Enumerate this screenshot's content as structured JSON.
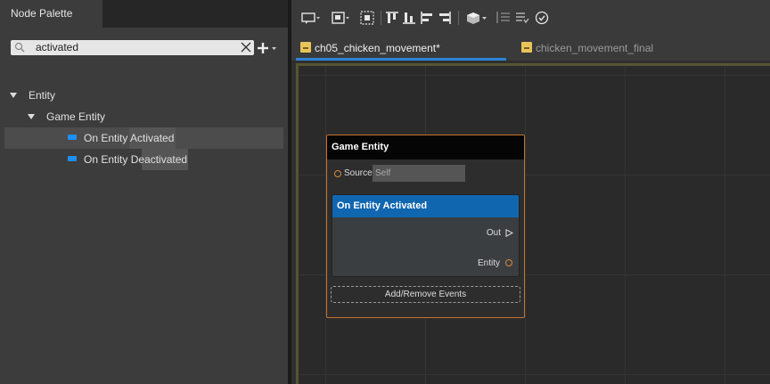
{
  "left_panel": {
    "tab_title": "Node Palette",
    "search": {
      "value": "activated"
    },
    "tree": {
      "category": "Entity",
      "subcategory": "Game Entity",
      "items": [
        {
          "label": "On Entity Activated"
        },
        {
          "label": "On Entity Deactivated"
        }
      ]
    }
  },
  "toolbar": {
    "icons": [
      "comment-icon",
      "group-icon",
      "select-icon",
      "align-top-icon",
      "align-bottom-icon",
      "align-left-icon",
      "align-right-icon",
      "3d-view-icon",
      "list-icon",
      "list-check-icon",
      "validate-icon"
    ]
  },
  "tabs": [
    {
      "label": "ch05_chicken_movement*",
      "active": true
    },
    {
      "label": "chicken_movement_final",
      "active": false
    }
  ],
  "node": {
    "title": "Game Entity",
    "source_label": "Source",
    "source_value": "Self",
    "event": {
      "title": "On Entity Activated",
      "out_label": "Out",
      "entity_label": "Entity"
    },
    "add_remove_label": "Add/Remove Events"
  },
  "colors": {
    "accent_blue": "#2d84d8",
    "event_header": "#1166b0",
    "node_border": "#c8742c",
    "pin_orange": "#d98a3c",
    "folder_yellow": "#e8c45a"
  }
}
